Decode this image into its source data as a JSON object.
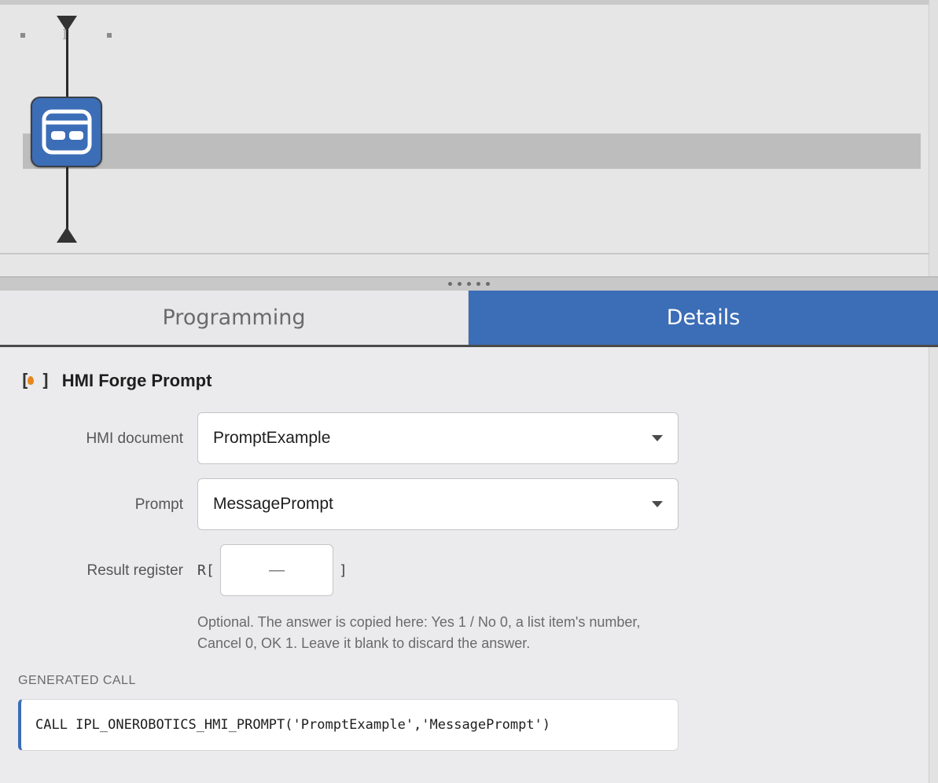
{
  "tabs": {
    "programming": "Programming",
    "details": "Details"
  },
  "details": {
    "title": "HMI Forge Prompt",
    "bracket_open": "[",
    "bracket_close": "]",
    "hmi_document": {
      "label": "HMI document",
      "value": "PromptExample"
    },
    "prompt": {
      "label": "Prompt",
      "value": "MessagePrompt"
    },
    "result_register": {
      "label": "Result register",
      "prefix": "R[",
      "suffix": "]",
      "placeholder": "—"
    },
    "help_text": "Optional. The answer is copied here: Yes 1 / No 0, a list item's number, Cancel 0, OK 1. Leave it blank to discard the answer.",
    "generated_label": "GENERATED CALL",
    "generated_call": "CALL IPL_ONEROBOTICS_HMI_PROMPT('PromptExample','MessagePrompt')"
  },
  "canvas": {
    "node_icon": "hmi-dialog-icon",
    "node_color": "#3c6db7",
    "marker_glyph": "I"
  },
  "colors": {
    "accent": "#3c6db7",
    "flame": "#e8861d"
  }
}
